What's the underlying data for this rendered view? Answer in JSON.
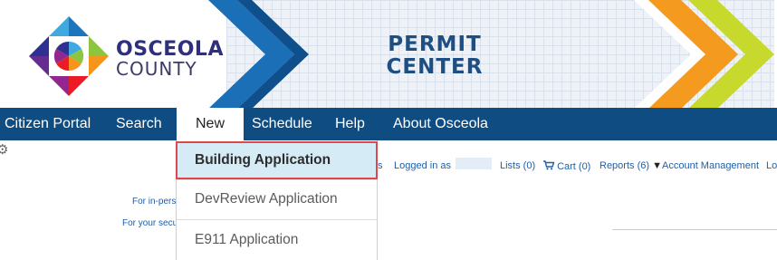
{
  "header": {
    "org_line1": "OSCEOLA",
    "org_line2": "COUNTY",
    "title_line1": "PERMIT",
    "title_line2": "CENTER"
  },
  "nav": {
    "items": [
      "Citizen Portal",
      "Search",
      "New",
      "Schedule",
      "Help",
      "About Osceola"
    ],
    "active": "New"
  },
  "dropdown": {
    "items": [
      "Building Application",
      "DevReview Application",
      "E911 Application"
    ],
    "selected": "Building Application"
  },
  "utility_bar": {
    "partial_left": "ts",
    "logged_in": "Logged in as",
    "lists": "Lists (0)",
    "cart": "Cart (0)",
    "reports": "Reports (6)",
    "account": "Account Management",
    "partial_right": "Lo"
  },
  "notes": {
    "line1": "For in-pers",
    "line2": "For your secu"
  },
  "colors": {
    "nav_bg": "#0f4c81",
    "title_blue": "#1f4f82",
    "highlight_bg": "#d5ecf7",
    "highlight_border": "#e0464a",
    "chevron_blue": "#1a6fb6",
    "chevron_orange": "#f39a1f",
    "chevron_lime": "#c7d92c"
  },
  "icons": [
    "gear-icon",
    "cart-icon",
    "dropdown-caret-icon",
    "osceola-logo"
  ]
}
